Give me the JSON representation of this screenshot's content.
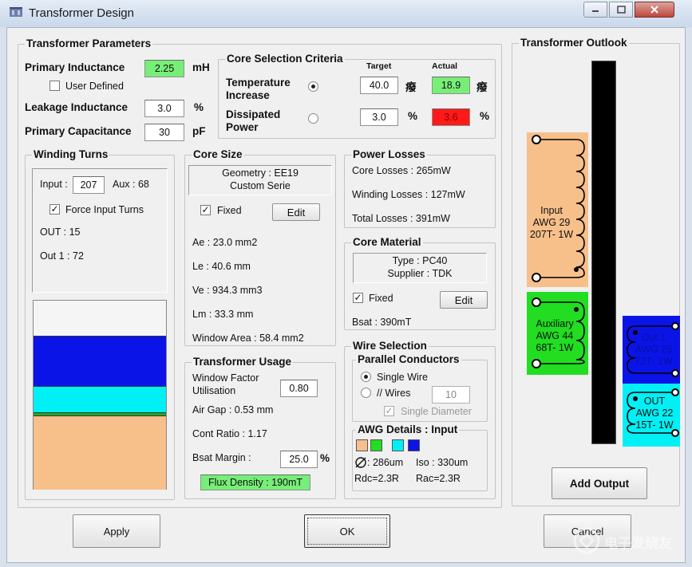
{
  "window": {
    "title": "Transformer Design",
    "app_icon": "transformer-app-icon",
    "controls": [
      "minimize-icon",
      "maximize-icon",
      "close-icon"
    ]
  },
  "params": {
    "title": "Transformer Parameters",
    "primary_inductance_label": "Primary Inductance",
    "primary_inductance_value": "2.25",
    "primary_inductance_unit": "mH",
    "user_defined_label": "User Defined",
    "user_defined_checked": false,
    "leakage_label": "Leakage Inductance",
    "leakage_value": "3.0",
    "leakage_unit": "%",
    "capacitance_label": "Primary Capacitance",
    "capacitance_value": "30",
    "capacitance_unit": "pF"
  },
  "core_criteria": {
    "title": "Core Selection Criteria",
    "target_header": "Target",
    "actual_header": "Actual",
    "temp_label_1": "Temperature",
    "temp_label_2": "Increase",
    "temp_target": "40.0",
    "temp_unit": "癈",
    "temp_actual": "18.9",
    "temp_actual_unit": "癈",
    "power_label_1": "Dissipated",
    "power_label_2": "Power",
    "power_target": "3.0",
    "power_unit": "%",
    "power_actual": "3.6",
    "power_actual_unit": "%",
    "selected": "temperature",
    "colors": {
      "ok": "#77ee77",
      "bad": "#ff1a1a"
    }
  },
  "winding_turns": {
    "title": "Winding Turns",
    "input_label": "Input :",
    "input_value": "207",
    "aux_text": "Aux : 68",
    "force_label": "Force Input Turns",
    "force_checked": true,
    "out_text": "OUT : 15",
    "out1_text": "Out 1 : 72",
    "bobbin_colors": {
      "blue": "#0a14e6",
      "cyan": "#00f0f5",
      "green": "#22aa22",
      "peach": "#f7c08a"
    }
  },
  "core_size": {
    "title": "Core Size",
    "geometry": "Geometry : EE19",
    "serie": "Custom Serie",
    "fixed_label": "Fixed",
    "fixed_checked": true,
    "edit_label": "Edit",
    "ae": "Ae : 23.0 mm2",
    "le": "Le : 40.6 mm",
    "ve": "Ve : 934.3 mm3",
    "lm": "Lm : 33.3 mm",
    "window_area": "Window Area : 58.4 mm2"
  },
  "power_losses": {
    "title": "Power Losses",
    "core": "Core Losses : 265mW",
    "winding": "Winding Losses : 127mW",
    "total": "Total Losses : 391mW"
  },
  "core_material": {
    "title": "Core Material",
    "type": "Type : PC40",
    "supplier": "Supplier : TDK",
    "fixed_label": "Fixed",
    "fixed_checked": true,
    "edit_label": "Edit",
    "bsat": "Bsat : 390mT"
  },
  "usage": {
    "title": "Transformer Usage",
    "wf_label_1": "Window Factor",
    "wf_label_2": "Utilisation",
    "wf_value": "0.80",
    "air_gap": "Air Gap : 0.53 mm",
    "cont_ratio": "Cont Ratio : 1.17",
    "bsat_margin_label": "Bsat Margin :",
    "bsat_margin_value": "25.0",
    "bsat_margin_unit": "%",
    "flux_density": "Flux Density : 190mT"
  },
  "wire_selection": {
    "title": "Wire Selection",
    "parallel_title": "Parallel Conductors",
    "single_wire_label": "Single Wire",
    "wires_label": "// Wires",
    "wires_value": "10",
    "single_diameter_label": "Single Diameter",
    "single_diameter_checked": true,
    "mode": "single"
  },
  "awg_details": {
    "title": "AWG Details : Input",
    "diameter": ": 286um",
    "diameter_icon": "diameter-icon",
    "iso": "Iso : 330um",
    "rdc": "Rdc=2.3R",
    "rac": "Rac=2.3R",
    "swatches": [
      "#f7c08a",
      "#22dd22",
      "#00f0f5",
      "#0a14e6"
    ]
  },
  "outlook": {
    "title": "Transformer Outlook",
    "windings": [
      {
        "name": "input",
        "lines": [
          "Input",
          "AWG 29",
          "207T- 1W"
        ],
        "color": "#f7c08a"
      },
      {
        "name": "auxiliary",
        "lines": [
          "Auxiliary",
          "AWG 44",
          "68T- 1W"
        ],
        "color": "#22dd22"
      },
      {
        "name": "out1",
        "lines": [
          "Out 1",
          "AWG 26",
          "72T- 1W"
        ],
        "color": "#0a14e6"
      },
      {
        "name": "out",
        "lines": [
          "OUT",
          "AWG 22",
          "15T- 1W"
        ],
        "color": "#00f0f5"
      }
    ],
    "add_output_label": "Add Output"
  },
  "footer": {
    "apply_label": "Apply",
    "ok_label": "OK",
    "cancel_label": "Cancel",
    "watermark": "电子发烧友"
  }
}
